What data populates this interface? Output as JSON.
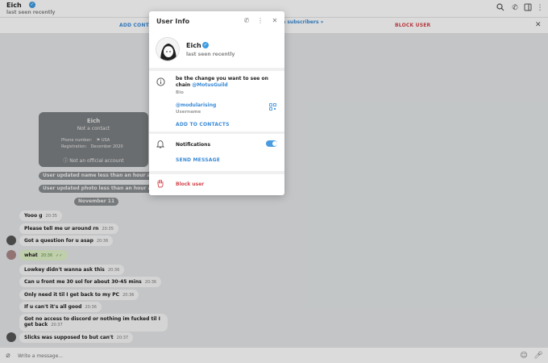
{
  "header": {
    "chat_name": "Eich",
    "status": "last seen recently"
  },
  "action_bar": {
    "add_contact": "ADD CONTA",
    "block_user": "BLOCK USER",
    "subscribers": "n subscribers »"
  },
  "contact_card": {
    "name": "Eich",
    "subtitle": "Not a contact",
    "phone_label": "Phone number:",
    "country": "USA",
    "registration_label": "Registration:",
    "registration_value": "December 2020",
    "official_note": "Not an official account"
  },
  "service_messages": [
    "User updated name less than an hour ago",
    "User updated photo less than an hour ago"
  ],
  "date_divider": "November 11",
  "messages": [
    {
      "text": "Yooo g",
      "time": "20:35",
      "own": false
    },
    {
      "text": "Please tell me ur around rn",
      "time": "20:35",
      "own": false
    },
    {
      "text": "Got a question for u asap",
      "time": "20:36",
      "own": false
    },
    {
      "text": "what",
      "time": "20:36",
      "own": true
    },
    {
      "text": "Lowkey didn't wanna ask this",
      "time": "20:36",
      "own": false
    },
    {
      "text": "Can u front me 30 sol for about 30-45 mins",
      "time": "20:36",
      "own": false
    },
    {
      "text": "Only need it til I get back to my PC",
      "time": "20:36",
      "own": false
    },
    {
      "text": "If u can't it's all good",
      "time": "20:36",
      "own": false
    },
    {
      "text": "Got no access to discord or nothing im fucked til I get back",
      "time": "20:37",
      "own": false
    },
    {
      "text": "Slicks was supposed to but can't",
      "time": "20:37",
      "own": false
    }
  ],
  "composer": {
    "placeholder": "Write a message..."
  },
  "modal": {
    "title": "User Info",
    "name": "Eich",
    "status": "last seen recently",
    "bio_text": "be the change you want to see on chain ",
    "bio_mention": "@MotusGuild",
    "bio_label": "Bio",
    "username": "@modularising",
    "username_label": "Username",
    "add_contacts": "ADD TO CONTACTS",
    "notifications_label": "Notifications",
    "notifications_enabled": true,
    "send_message": "SEND MESSAGE",
    "block_user": "Block user"
  },
  "colors": {
    "accent": "#3a8ad6",
    "danger": "#d4444a",
    "own_bubble": "#dff0c8"
  }
}
